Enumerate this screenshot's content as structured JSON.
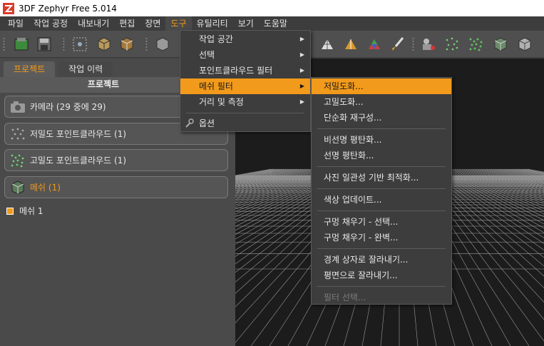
{
  "window": {
    "title": "3DF Zephyr Free 5.014"
  },
  "menubar": {
    "items": [
      "파일",
      "작업 공정",
      "내보내기",
      "편집",
      "장면",
      "도구",
      "유틸리티",
      "보기",
      "도움말"
    ],
    "active_index": 5
  },
  "left_panel": {
    "tabs": [
      "프로젝트",
      "작업 이력"
    ],
    "header": "프로젝트",
    "groups": [
      {
        "label": "카메라 (29 중에 29)",
        "icon": "camera-icon"
      },
      {
        "label": "저밀도 포인트클라우드 (1)",
        "icon": "sparse-cloud-icon"
      },
      {
        "label": "고밀도 포인트클라우드 (1)",
        "icon": "dense-cloud-icon"
      },
      {
        "label": "메쉬 (1)",
        "icon": "mesh-icon"
      }
    ],
    "tree_item": "메쉬 1"
  },
  "tools_menu": {
    "items": [
      "작업 공간",
      "선택",
      "포인트클라우드 필터",
      "메쉬 필터",
      "거리 및 측정",
      "옵션"
    ],
    "highlighted": "메쉬 필터"
  },
  "mesh_filter_menu": {
    "items": [
      "저밀도화...",
      "고밀도화...",
      "단순화 재구성...",
      "비선명 평탄화...",
      "선명 평탄화...",
      "사진 일관성 기반 최적화...",
      "색상 업데이트...",
      "구멍 채우기 - 선택...",
      "구멍 채우기 - 완벽...",
      "경계 상자로 잘라내기...",
      "평면으로 잘라내기...",
      "필터 선택..."
    ],
    "highlighted": "저밀도화...",
    "disabled": "필터 선택..."
  },
  "colors": {
    "accent": "#f29a1b",
    "viewport_bg": "#1c1c1c"
  }
}
